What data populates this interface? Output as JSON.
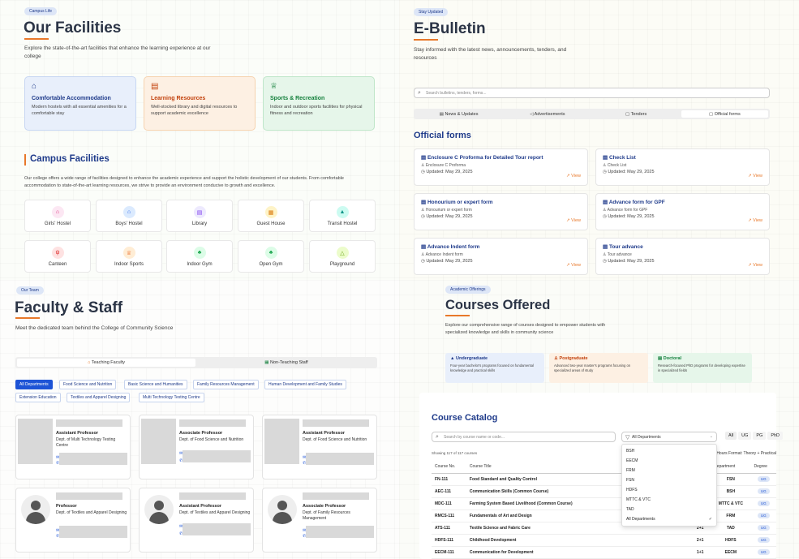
{
  "facilities": {
    "pill": "Campus Life",
    "title": "Our Facilities",
    "subtitle": "Explore the state-of-the-art facilities that enhance the learning experience at our college",
    "cards": [
      {
        "icon": "⌂",
        "title": "Comfortable Accommodation",
        "desc": "Modern hostels with all essential amenities for a comfortable stay",
        "color": "#1e3a8a"
      },
      {
        "icon": "▤",
        "title": "Learning Resources",
        "desc": "Well-stocked library and digital resources to support academic excellence",
        "color": "#c2410c"
      },
      {
        "icon": "♕",
        "title": "Sports & Recreation",
        "desc": "Indoor and outdoor sports facilities for physical fitness and recreation",
        "color": "#15803d"
      }
    ],
    "campus_title": "Campus Facilities",
    "campus_desc": "Our college offers a wide range of facilities designed to enhance the academic experience and support the holistic development of our students. From comfortable accommodation to state-of-the-art learning resources, we strive to provide an environment conducive to growth and excellence.",
    "items": [
      {
        "label": "Girls' Hostel",
        "icon": "⌂",
        "bg": "#fce7f3",
        "fg": "#db2777"
      },
      {
        "label": "Boys' Hostel",
        "icon": "⌂",
        "bg": "#dbeafe",
        "fg": "#2563eb"
      },
      {
        "label": "Library",
        "icon": "▤",
        "bg": "#ede9fe",
        "fg": "#7c3aed"
      },
      {
        "label": "Guest House",
        "icon": "▦",
        "bg": "#fef3c7",
        "fg": "#d97706"
      },
      {
        "label": "Transit Hostel",
        "icon": "▲",
        "bg": "#ccfbf1",
        "fg": "#0d9488"
      },
      {
        "label": "Canteen",
        "icon": "ψ",
        "bg": "#fee2e2",
        "fg": "#dc2626"
      },
      {
        "label": "Indoor Sports",
        "icon": "♕",
        "bg": "#ffedd5",
        "fg": "#ea580c"
      },
      {
        "label": "Indoor Gym",
        "icon": "♣",
        "bg": "#dcfce7",
        "fg": "#16a34a"
      },
      {
        "label": "Open Gym",
        "icon": "♣",
        "bg": "#dcfce7",
        "fg": "#16a34a"
      },
      {
        "label": "Playground",
        "icon": "△",
        "bg": "#ecfccb",
        "fg": "#65a30d"
      }
    ]
  },
  "bulletin": {
    "pill": "Stay Updated",
    "title": "E-Bulletin",
    "subtitle": "Stay informed with the latest news, announcements, tenders, and resources",
    "search_placeholder": "Search bulletins, tenders, forms...",
    "tabs": [
      "News & Updates",
      "Advertisements",
      "Tenders",
      "Official forms"
    ],
    "section_title": "Official forms",
    "view_label": "View",
    "forms": [
      {
        "title": "Enclosure C Proforma for Detailed Tour report",
        "sub": "Enclosure C Proforma",
        "updated": "Updated: May 29, 2025"
      },
      {
        "title": "Check List",
        "sub": "Check List",
        "updated": "Updated: May 29, 2025"
      },
      {
        "title": "Honourium or expert form",
        "sub": "Honourium or expert form",
        "updated": "Updated: May 29, 2025"
      },
      {
        "title": "Advance form for GPF",
        "sub": "Advance form for GPF",
        "updated": "Updated: May 29, 2025"
      },
      {
        "title": "Advance Indent form",
        "sub": "Advance Indent form",
        "updated": "Updated: May 29, 2025"
      },
      {
        "title": "Tour advance",
        "sub": "Tour advance",
        "updated": "Updated: May 29, 2025"
      }
    ]
  },
  "faculty": {
    "pill": "Our Team",
    "title": "Faculty & Staff",
    "subtitle": "Meet the dedicated team behind the College of Community Science",
    "tabs": [
      "Teaching Faculty",
      "Non-Teaching Staff"
    ],
    "departments": [
      "All Departments",
      "Food Science and Nutrition",
      "Basic Science and Humanities",
      "Family Resources Management",
      "Human Development and Family Studies",
      "Extension Education",
      "Textiles and Apparel Designing",
      "Multi Technology Testing Centre"
    ],
    "cards": [
      {
        "role": "Assistant Professor",
        "dept": "Dept. of Multi Technology Testing Centre"
      },
      {
        "role": "Associate Professor",
        "dept": "Dept. of Food Science and Nutrition"
      },
      {
        "role": "Assistant Professor",
        "dept": "Dept. of Food Science and Nutrition"
      },
      {
        "role": "Professor",
        "dept": "Dept. of Textiles and Apparel Designing"
      },
      {
        "role": "Assistant Professor",
        "dept": "Dept. of Textiles and Apparel Designing"
      },
      {
        "role": "Associate Professor",
        "dept": "Dept. of Family Resources Management"
      }
    ]
  },
  "courses": {
    "pill": "Academic Offerings",
    "title": "Courses Offered",
    "subtitle": "Explore our comprehensive range of courses designed to empower students with specialized knowledge and skills in community science",
    "levels": [
      {
        "title": "Undergraduate",
        "desc": "Four-year bachelor's programs focused on fundamental knowledge and practical skills",
        "bg": "#e8effb",
        "fg": "#1e3a8a"
      },
      {
        "title": "Postgraduate",
        "desc": "Advanced two-year master's programs focusing on specialized areas of study",
        "bg": "#fdf0e3",
        "fg": "#c2410c"
      },
      {
        "title": "Doctoral",
        "desc": "Research-focused PhD programs for developing expertise in specialized fields",
        "bg": "#e6f6ea",
        "fg": "#15803d"
      }
    ],
    "catalog_title": "Course Catalog",
    "search_placeholder": "Search by course name or code...",
    "filter_label": "All Departments",
    "degree_filters": [
      "All",
      "UG",
      "PG",
      "PhD"
    ],
    "showing": "Showing 117 of 117 courses",
    "format_note": "Hours Format: Theory + Practical",
    "dropdown_options": [
      "BSH",
      "EECM",
      "FRM",
      "FSN",
      "HDFS",
      "MTTC & VTC",
      "TAD",
      "All Departments"
    ],
    "columns": [
      "Course No.",
      "Course Title",
      "",
      "Department",
      "Degree"
    ],
    "rows": [
      {
        "no": "FN-111",
        "title": "Food Standard and Quality Control",
        "hours": "",
        "dept": "FSN",
        "degree": "UG"
      },
      {
        "no": "AEC-111",
        "title": "Communication Skills (Common Course)",
        "hours": "",
        "dept": "BSH",
        "degree": "UG"
      },
      {
        "no": "MDC-111",
        "title": "Farming System Based Livelihood (Common Course)",
        "hours": "",
        "dept": "MTTC & VTC",
        "degree": "UG"
      },
      {
        "no": "RMCS-111",
        "title": "Fundamentals of Art and Design",
        "hours": "",
        "dept": "FRM",
        "degree": "UG"
      },
      {
        "no": "ATS-111",
        "title": "Textile Science and Fabric Care",
        "hours": "2+1",
        "dept": "TAD",
        "degree": "UG"
      },
      {
        "no": "HDFS-111",
        "title": "Childhood Development",
        "hours": "2+1",
        "dept": "HDFS",
        "degree": "UG"
      },
      {
        "no": "EECM-111",
        "title": "Communication for Development",
        "hours": "1+1",
        "dept": "EECM",
        "degree": "UG"
      }
    ]
  }
}
